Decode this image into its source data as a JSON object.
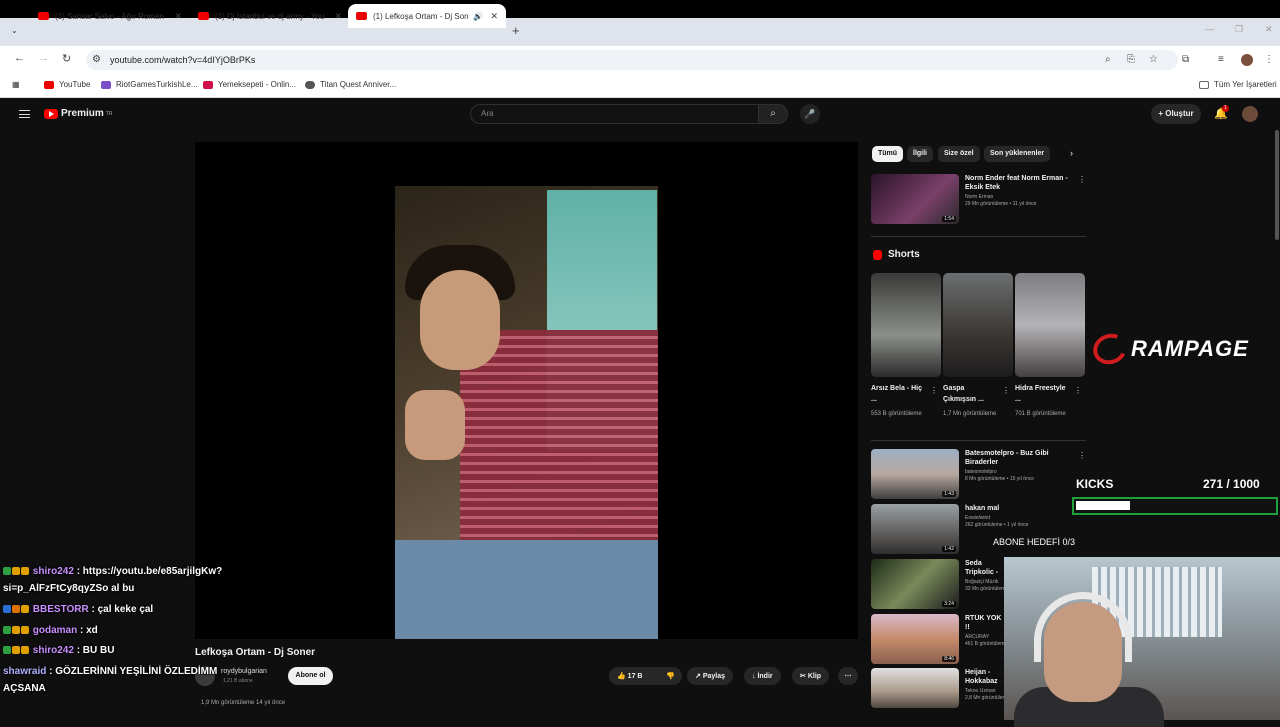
{
  "browser": {
    "tabs": [
      {
        "title": "(1) Sansar Salvo - Ağır Roman"
      },
      {
        "title": "(1) Dj İstanbul ve dj army - You"
      },
      {
        "title": "(1) Lefkoşa Ortam - Dj Sone"
      }
    ],
    "url": "youtube.com/watch?v=4dIYjOBrPKs",
    "bookmarks": [
      "YouTube",
      "RiotGamesTurkishLe...",
      "Yemeksepeti - Onlin...",
      "Titan Quest Anniver..."
    ],
    "all_bookmarks": "Tüm Yer İşaretleri"
  },
  "youtube": {
    "logo": "Premium",
    "logo_region": "TR",
    "search_placeholder": "Ara",
    "create_label": "Oluştur",
    "bell_count": "1"
  },
  "video": {
    "title": "Lefkoşa Ortam - Dj Soner",
    "channel": "roydybulgarian",
    "subscribers": "1,21 B abone",
    "subscribe_label": "Abone ol",
    "likes": "17 B",
    "share": "Paylaş",
    "download": "İndir",
    "clip": "Klip",
    "meta": "1,9 Mn görüntüleme  14 yıl önce"
  },
  "sidebar": {
    "chips": [
      "Tümü",
      "İlgili",
      "Size özel",
      "Son yüklenenler"
    ],
    "top_rec": {
      "title": "Norm Ender feat Norm Erman - Eksik Etek",
      "channel": "Norm Erman",
      "views": "29 Mn görüntüleme • 11 yıl önce",
      "duration": "1:54"
    },
    "shorts_title": "Shorts",
    "shorts": [
      {
        "title": "Arsız Bela - Hiç ...",
        "views": "553 B görüntüleme"
      },
      {
        "title": "Gaspa Çıkmışsın ...",
        "views": "1,7 Mn görüntüleme"
      },
      {
        "title": "Hidra Freestyle ...",
        "views": "701 B görüntüleme"
      }
    ],
    "recs": [
      {
        "title": "Batesmotelpro - Buz Gibi Biraderler",
        "channel": "batesmotelpro",
        "views": "8 Mn görüntüleme • 15 yıl önce",
        "duration": "1:43"
      },
      {
        "title": "hakan mal",
        "channel": "Eowielwind",
        "views": "262 görüntüleme • 1 yıl önce",
        "duration": "1:42"
      },
      {
        "title": "Seda Tripkolic - Yeşilini Özledim",
        "channel": "Boğaziçi Müzik",
        "views": "33 Mn görüntüleme",
        "duration": "3:24"
      },
      {
        "title": "RTÜK YOK !!",
        "channel": "ARCURAY",
        "views": "461 B görüntüleme",
        "duration": "8:46"
      },
      {
        "title": "Heijan - Hokkabaz Yarız Yokuz",
        "channel": "Tekno Uzman",
        "views": "2,8 Mn görüntüleme",
        "duration": ""
      }
    ]
  },
  "overlay": {
    "brand": "RAMPAGE",
    "kicks_label": "KICKS",
    "kicks_count": "271  / 1000",
    "kicks_progress": 0.271,
    "abone_goal": "ABONE HEDEFİ  0/3",
    "chat": [
      {
        "user": "shiro242",
        "msg": ": https://youtu.be/e85arjilgKw?",
        "color": "#c890ff"
      },
      {
        "user": "",
        "msg": "si=p_AlFzFtCy8qyZSo al bu",
        "color": "#ffffff"
      },
      {
        "user": "BBESTORR",
        "msg": ": çal keke çal",
        "color": "#c890ff"
      },
      {
        "user": "godaman",
        "msg": ": xd",
        "color": "#c890ff"
      },
      {
        "user": "shiro242",
        "msg": ": BU BU",
        "color": "#c890ff"
      },
      {
        "user": "shawraid",
        "msg": ": GÖZLERİNNİ YEŞİLİNİ ÖZLEDİMM",
        "color": "#b0b0ff"
      },
      {
        "user": "",
        "msg": "AÇSANA",
        "color": "#ffffff"
      }
    ]
  }
}
